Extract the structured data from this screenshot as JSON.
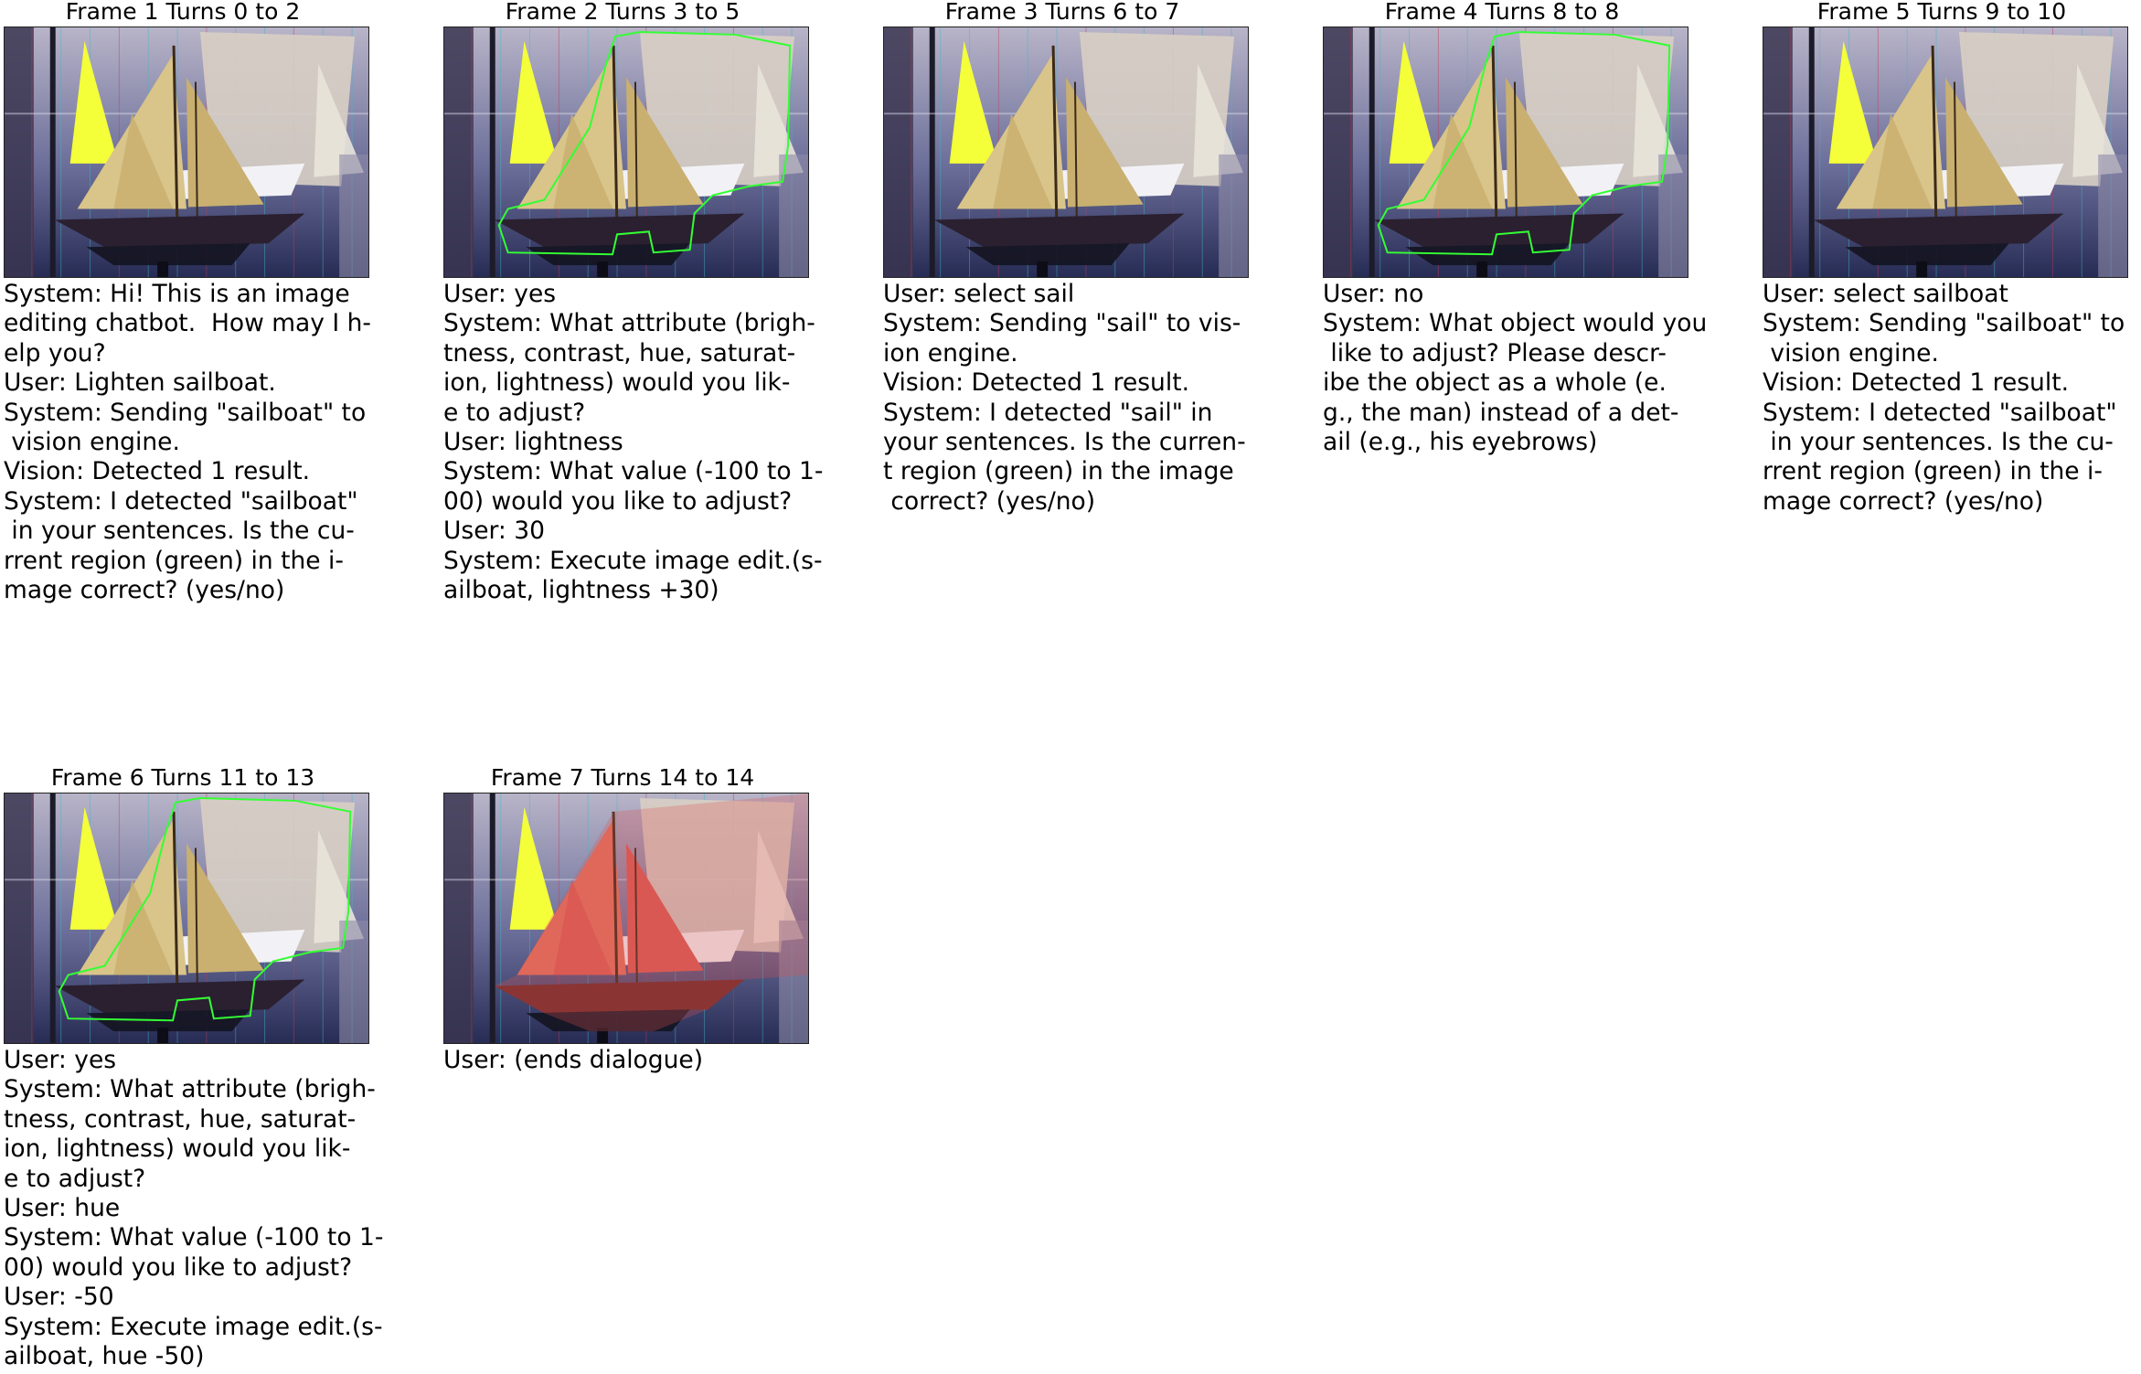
{
  "frames": [
    {
      "title": "Frame 1 Turns 0 to 2",
      "image": {
        "outline": "none",
        "overlay": "none"
      },
      "lines": [
        "System: Hi! This is an image",
        "editing chatbot.  How may I h-",
        "elp you?",
        "User: Lighten sailboat.",
        "System: Sending \"sailboat\" to",
        " vision engine.",
        "Vision: Detected 1 result.",
        "System: I detected \"sailboat\"",
        " in your sentences. Is the cu-",
        "rrent region (green) in the i-",
        "mage correct? (yes/no)"
      ]
    },
    {
      "title": "Frame 2 Turns 3 to 5",
      "image": {
        "outline": "sailboat",
        "overlay": "none"
      },
      "lines": [
        "User: yes",
        "System: What attribute (brigh-",
        "tness, contrast, hue, saturat-",
        "ion, lightness) would you lik-",
        "e to adjust?",
        "User: lightness",
        "System: What value (-100 to 1-",
        "00) would you like to adjust?",
        "User: 30",
        "System: Execute image edit.(s-",
        "ailboat, lightness +30)"
      ]
    },
    {
      "title": "Frame 3 Turns 6 to 7",
      "image": {
        "outline": "none",
        "overlay": "none"
      },
      "lines": [
        "User: select sail",
        "System: Sending \"sail\" to vis-",
        "ion engine.",
        "Vision: Detected 1 result.",
        "System: I detected \"sail\" in",
        "your sentences. Is the curren-",
        "t region (green) in the image",
        " correct? (yes/no)"
      ]
    },
    {
      "title": "Frame 4 Turns 8 to 8",
      "image": {
        "outline": "sailboat",
        "overlay": "none"
      },
      "lines": [
        "User: no",
        "System: What object would you",
        " like to adjust? Please descr-",
        "ibe the object as a whole (e.",
        "g., the man) instead of a det-",
        "ail (e.g., his eyebrows)"
      ]
    },
    {
      "title": "Frame 5 Turns 9 to 10",
      "image": {
        "outline": "none",
        "overlay": "none"
      },
      "lines": [
        "User: select sailboat",
        "System: Sending \"sailboat\" to",
        " vision engine.",
        "Vision: Detected 1 result.",
        "System: I detected \"sailboat\"",
        " in your sentences. Is the cu-",
        "rrent region (green) in the i-",
        "mage correct? (yes/no)"
      ]
    },
    {
      "title": "Frame 6 Turns 11 to 13",
      "image": {
        "outline": "sailboat",
        "overlay": "none"
      },
      "lines": [
        "User: yes",
        "System: What attribute (brigh-",
        "tness, contrast, hue, saturat-",
        "ion, lightness) would you lik-",
        "e to adjust?",
        "User: hue",
        "System: What value (-100 to 1-",
        "00) would you like to adjust?",
        "User: -50",
        "System: Execute image edit.(s-",
        "ailboat, hue -50)"
      ]
    },
    {
      "title": "Frame 7 Turns 14 to 14",
      "image": {
        "outline": "none",
        "overlay": "red-hue"
      },
      "lines": [
        "User: (ends dialogue)"
      ]
    }
  ],
  "colors": {
    "region_outline": "#33ff33",
    "hue_tint": "#e0524f"
  }
}
